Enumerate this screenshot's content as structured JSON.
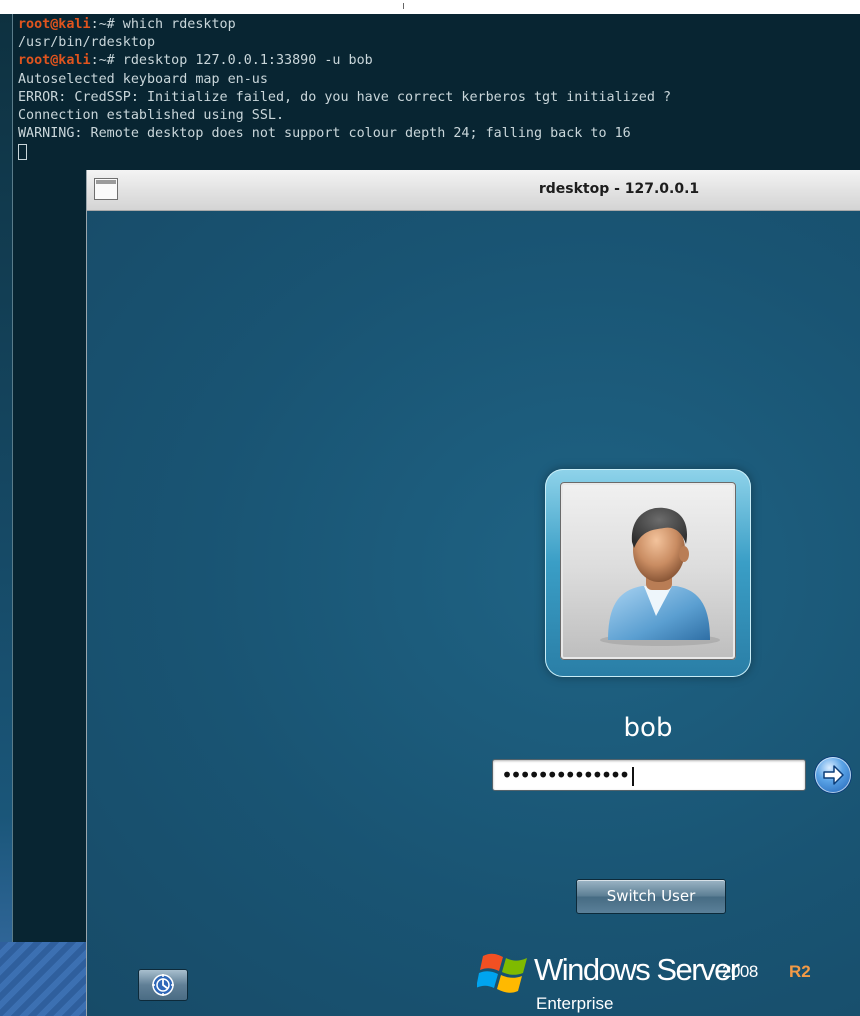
{
  "terminal": {
    "lines": [
      {
        "user": "root@kali",
        "path": ":~#",
        "cmd": " which rdesktop"
      },
      {
        "text": "/usr/bin/rdesktop"
      },
      {
        "user": "root@kali",
        "path": ":~#",
        "cmd": " rdesktop 127.0.0.1:33890 -u bob"
      },
      {
        "text": "Autoselected keyboard map en-us"
      },
      {
        "text": "ERROR: CredSSP: Initialize failed, do you have correct kerberos tgt initialized ?"
      },
      {
        "text": "Connection established using SSL."
      },
      {
        "text": "WARNING: Remote desktop does not support colour depth 24; falling back to 16"
      }
    ]
  },
  "window": {
    "title": "rdesktop - 127.0.0.1"
  },
  "login": {
    "username": "bob",
    "password_masked": "••••••••••••••",
    "switch_user_label": "Switch User"
  },
  "branding": {
    "product": "Windows Server",
    "version": "2008",
    "release": "R2",
    "edition": "Enterprise"
  },
  "colors": {
    "prompt_user": "#e0541e",
    "terminal_bg": "#082532",
    "login_bg": "#1b5475",
    "r2_accent": "#f39a46"
  },
  "icons": {
    "avatar": "user-avatar-icon",
    "submit": "arrow-right-icon",
    "ease_of_access": "ease-of-access-icon",
    "logo": "windows-flag-icon"
  }
}
